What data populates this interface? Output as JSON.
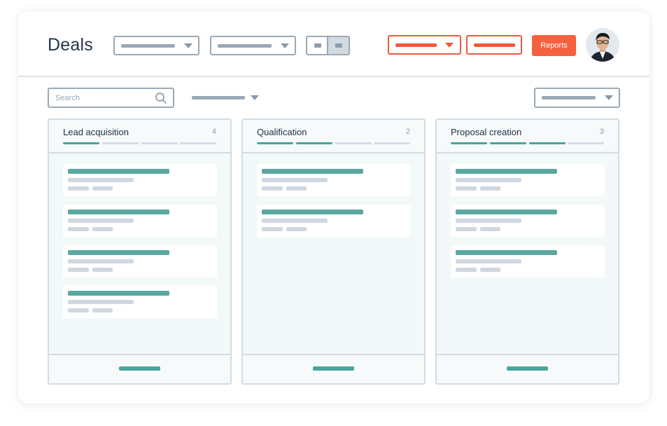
{
  "header": {
    "title": "Deals",
    "reports_label": "Reports"
  },
  "toolbar": {
    "search_placeholder": "Search"
  },
  "columns": [
    {
      "title": "Lead acquisition",
      "count": "4",
      "progress_filled": 1,
      "progress_total": 4,
      "deals": 4
    },
    {
      "title": "Qualification",
      "count": "2",
      "progress_filled": 2,
      "progress_total": 4,
      "deals": 2
    },
    {
      "title": "Proposal creation",
      "count": "3",
      "progress_filled": 3,
      "progress_total": 4,
      "deals": 3
    }
  ],
  "colors": {
    "accent": "#f5603f",
    "teal": "#4aa59c",
    "border": "#9aa9b7",
    "text": "#24364a"
  },
  "icons": [
    "search-icon",
    "chevron-down-icon",
    "avatar"
  ]
}
